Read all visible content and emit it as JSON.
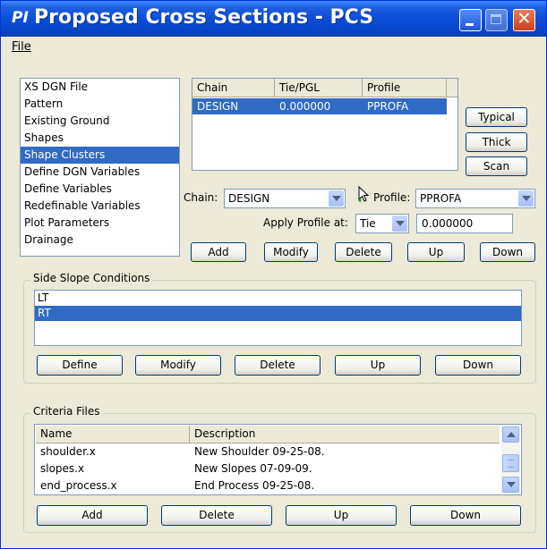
{
  "window": {
    "title": "Proposed Cross Sections - PCS",
    "icon_glyph": "PI",
    "title_color": "#0a4ed8"
  },
  "menu": {
    "file_label": "File"
  },
  "nav": {
    "items": [
      {
        "label": "XS DGN File"
      },
      {
        "label": "Pattern"
      },
      {
        "label": "Existing Ground"
      },
      {
        "label": "Shapes"
      },
      {
        "label": "Shape Clusters",
        "selected": true
      },
      {
        "label": "Define DGN Variables"
      },
      {
        "label": "Define Variables"
      },
      {
        "label": "Redefinable Variables"
      },
      {
        "label": "Plot Parameters"
      },
      {
        "label": "Drainage"
      }
    ]
  },
  "chain_table": {
    "headers": [
      "Chain",
      "Tie/PGL",
      "Profile"
    ],
    "rows": [
      [
        "DESIGN",
        "0.000000",
        "PPROFA"
      ]
    ]
  },
  "side_buttons": {
    "typical": "Typical",
    "thick": "Thick",
    "scan": "Scan"
  },
  "chain_form": {
    "chain_label": "Chain:",
    "chain_value": "DESIGN",
    "profile_label": "Profile:",
    "profile_value": "PPROFA",
    "apply_label": "Apply Profile at:",
    "apply_value": "Tie",
    "offset_value": "0.000000"
  },
  "cluster_buttons": {
    "add": "Add",
    "modify": "Modify",
    "delete": "Delete",
    "up": "Up",
    "down": "Down"
  },
  "side_slope": {
    "title": "Side Slope Conditions",
    "items": [
      {
        "label": "LT"
      },
      {
        "label": "RT",
        "selected": true
      }
    ],
    "buttons": {
      "define": "Define",
      "modify": "Modify",
      "delete": "Delete",
      "up": "Up",
      "down": "Down"
    }
  },
  "criteria": {
    "title": "Criteria Files",
    "headers": [
      "Name",
      "Description"
    ],
    "rows": [
      [
        "shoulder.x",
        "New Shoulder 09-25-08."
      ],
      [
        "slopes.x",
        "New Slopes 07-09-09."
      ],
      [
        "end_process.x",
        "End Process 09-25-08."
      ]
    ],
    "buttons": {
      "add": "Add",
      "delete": "Delete",
      "up": "Up",
      "down": "Down"
    }
  },
  "colors": {
    "selection": "#316ac5",
    "dialog_bg": "#ece9d8",
    "titlebar": "#0a4ed8"
  }
}
